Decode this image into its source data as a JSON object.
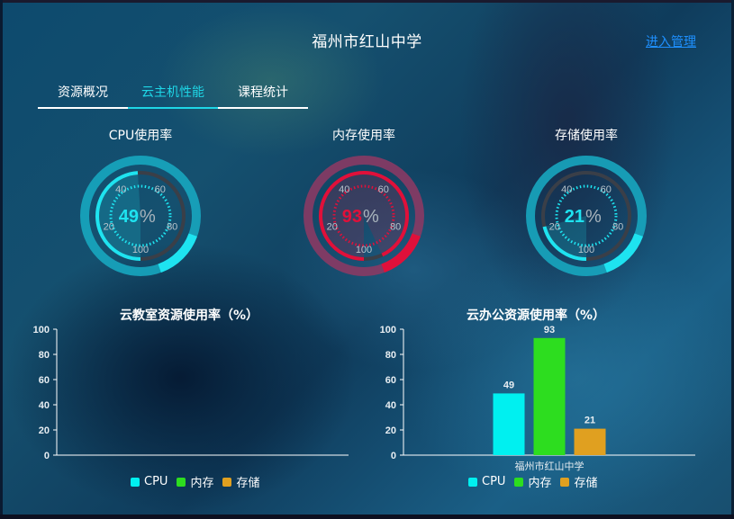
{
  "header": {
    "title": "福州市红山中学",
    "admin_link": "进入管理"
  },
  "tabs": [
    {
      "label": "资源概况",
      "active": false
    },
    {
      "label": "云主机性能",
      "active": true
    },
    {
      "label": "课程统计",
      "active": false
    }
  ],
  "gauges": [
    {
      "title": "CPU使用率",
      "value": 49,
      "unit": "%",
      "color": "#1ee3f0",
      "ring_color": "#17a6bf",
      "ticks": [
        "20",
        "40",
        "60",
        "80",
        "100"
      ]
    },
    {
      "title": "内存使用率",
      "value": 93,
      "unit": "%",
      "color": "#e0103a",
      "ring_color": "#8a3a64",
      "ticks": [
        "20",
        "40",
        "60",
        "80",
        "100"
      ]
    },
    {
      "title": "存储使用率",
      "value": 21,
      "unit": "%",
      "color": "#1ee3f0",
      "ring_color": "#17a6bf",
      "ticks": [
        "20",
        "40",
        "60",
        "80",
        "100"
      ]
    }
  ],
  "chart_data": [
    {
      "type": "bar",
      "title": "云教室资源使用率（%）",
      "categories": [],
      "series": [
        {
          "name": "CPU",
          "color": "#00f0f0",
          "values": []
        },
        {
          "name": "内存",
          "color": "#2ddd1f",
          "values": []
        },
        {
          "name": "存储",
          "color": "#e0a020",
          "values": []
        }
      ],
      "yticks": [
        "0",
        "20",
        "40",
        "60",
        "80",
        "100"
      ],
      "ylim": [
        0,
        100
      ],
      "xlabel": "",
      "ylabel": "",
      "legend": "bottom-center"
    },
    {
      "type": "bar",
      "title": "云办公资源使用率（%）",
      "categories": [
        "福州市红山中学"
      ],
      "series": [
        {
          "name": "CPU",
          "color": "#00f0f0",
          "values": [
            49
          ]
        },
        {
          "name": "内存",
          "color": "#2ddd1f",
          "values": [
            93
          ]
        },
        {
          "name": "存储",
          "color": "#e0a020",
          "values": [
            21
          ]
        }
      ],
      "yticks": [
        "0",
        "20",
        "40",
        "60",
        "80",
        "100"
      ],
      "ylim": [
        0,
        100
      ],
      "xlabel": "",
      "ylabel": "",
      "legend": "bottom-center"
    }
  ]
}
